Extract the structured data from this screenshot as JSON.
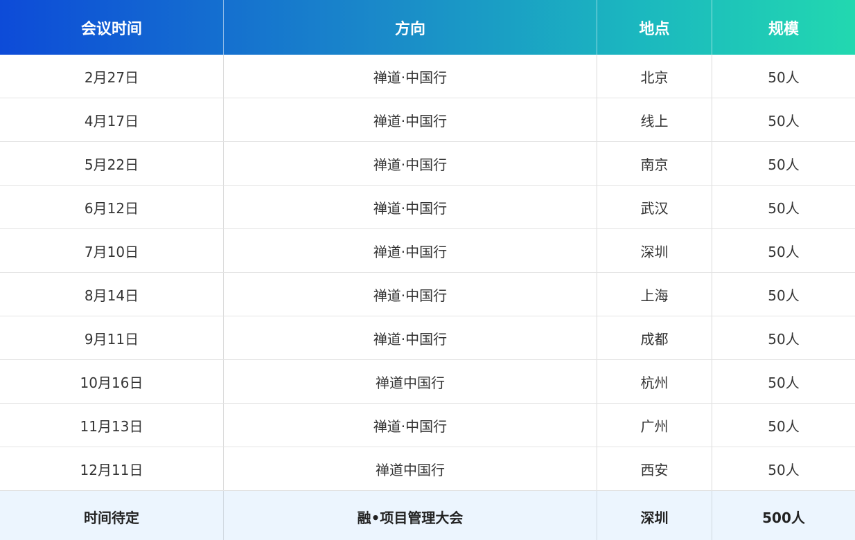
{
  "header": {
    "col_time": "会议时间",
    "col_direction": "方向",
    "col_location": "地点",
    "col_scale": "规模"
  },
  "rows": [
    {
      "date": "2月27日",
      "direction": "禅道·中国行",
      "location": "北京",
      "scale": "50人"
    },
    {
      "date": "4月17日",
      "direction": "禅道·中国行",
      "location": "线上",
      "scale": "50人"
    },
    {
      "date": "5月22日",
      "direction": "禅道·中国行",
      "location": "南京",
      "scale": "50人"
    },
    {
      "date": "6月12日",
      "direction": "禅道·中国行",
      "location": "武汉",
      "scale": "50人"
    },
    {
      "date": "7月10日",
      "direction": "禅道·中国行",
      "location": "深圳",
      "scale": "50人"
    },
    {
      "date": "8月14日",
      "direction": "禅道·中国行",
      "location": "上海",
      "scale": "50人"
    },
    {
      "date": "9月11日",
      "direction": "禅道·中国行",
      "location": "成都",
      "scale": "50人"
    },
    {
      "date": "10月16日",
      "direction": "禅道中国行",
      "location": "杭州",
      "scale": "50人"
    },
    {
      "date": "11月13日",
      "direction": "禅道·中国行",
      "location": "广州",
      "scale": "50人"
    },
    {
      "date": "12月11日",
      "direction": "禅道中国行",
      "location": "西安",
      "scale": "50人"
    }
  ],
  "footer": {
    "date": "时间待定",
    "direction": "融•项目管理大会",
    "location": "深圳",
    "scale": "500人"
  },
  "colors": {
    "header_gradient_start": "#0d4bd8",
    "header_gradient_end": "#22d8b0",
    "footer_bg": "#ecf5fe"
  }
}
